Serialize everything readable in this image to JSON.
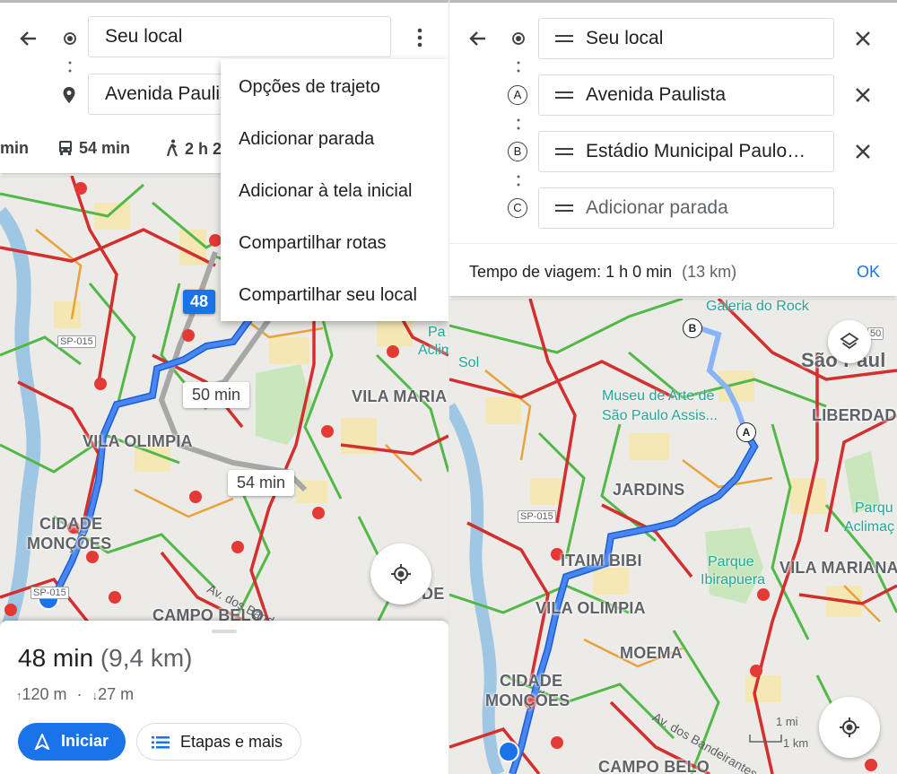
{
  "left": {
    "origin_field": "Seu local",
    "destination_field": "Avenida Paulis",
    "modes": {
      "car": "min",
      "transit": "54 min",
      "walk": "2 h 2"
    },
    "menu": [
      "Opções de trajeto",
      "Adicionar parada",
      "Adicionar à tela inicial",
      "Compartilhar rotas",
      "Compartilhar seu local"
    ],
    "map": {
      "labels": {
        "vila_olimpia": "VILA OLIMPIA",
        "vila_maria": "VILA MARIA",
        "cidade": "CIDADE",
        "moncoes": "MONÇÕES",
        "campo_belo": "CAMPO BELO",
        "de": "DE"
      },
      "pois": {
        "pa": "Pa",
        "aclim": "Aclim"
      },
      "road": "Av. dos Bandeirante",
      "shields": {
        "sp015": "SP-015",
        "sp015b": "SP-015"
      },
      "alt_times": {
        "t48": "48",
        "t50": "50 min",
        "t54": "54 min"
      }
    },
    "sheet": {
      "duration": "48 min",
      "distance": "(9,4 km)",
      "ascent": "120 m",
      "dot": "·",
      "descent": "27 m",
      "start_button": "Iniciar",
      "steps_button": "Etapas e mais"
    }
  },
  "right": {
    "stops": [
      {
        "marker": "",
        "label": "Seu local",
        "removable": true
      },
      {
        "marker": "A",
        "label": "Avenida Paulista",
        "removable": true
      },
      {
        "marker": "B",
        "label": "Estádio Municipal Paulo…",
        "removable": true
      },
      {
        "marker": "C",
        "label": "Adicionar parada",
        "removable": false
      }
    ],
    "travel_time": "Tempo de viagem: 1 h 0 min",
    "travel_distance": "(13 km)",
    "ok_button": "OK",
    "map": {
      "labels": {
        "jardins": "JARDINS",
        "itaim": "ITAIM BIBI",
        "vila_olimpia": "VILA OLIMPIA",
        "moema": "MOEMA",
        "cidade": "CIDADE",
        "moncoes": "MONÇÕES",
        "campo_belo": "CAMPO BELO",
        "liberdade": "LIBERDADE",
        "vila_mariana": "VILA MARIANA",
        "sao_paulo": "São Paul"
      },
      "pois": {
        "galeria": "Galeria do Rock",
        "museu1": "Museu de Arte de",
        "museu2": "São Paulo Assis...",
        "sol": "Sol",
        "parque1": "Parque",
        "parque2": "Ibirapuera",
        "parq_acl1": "Parqu",
        "parq_acl2": "Aclimaç"
      },
      "road": "Av. dos Bandeirantes",
      "shields": {
        "sp015": "SP-015",
        "n50": "50"
      },
      "scale": {
        "mi": "1 mi",
        "km": "1 km"
      },
      "markers": {
        "a": "A",
        "b": "B"
      }
    }
  },
  "colors": {
    "route": "#4a85f4",
    "alt_route": "#a7a7a7",
    "heavy": "#d32f2f",
    "medium": "#e8a33a",
    "free": "#52b848",
    "accent": "#1a73e8"
  }
}
